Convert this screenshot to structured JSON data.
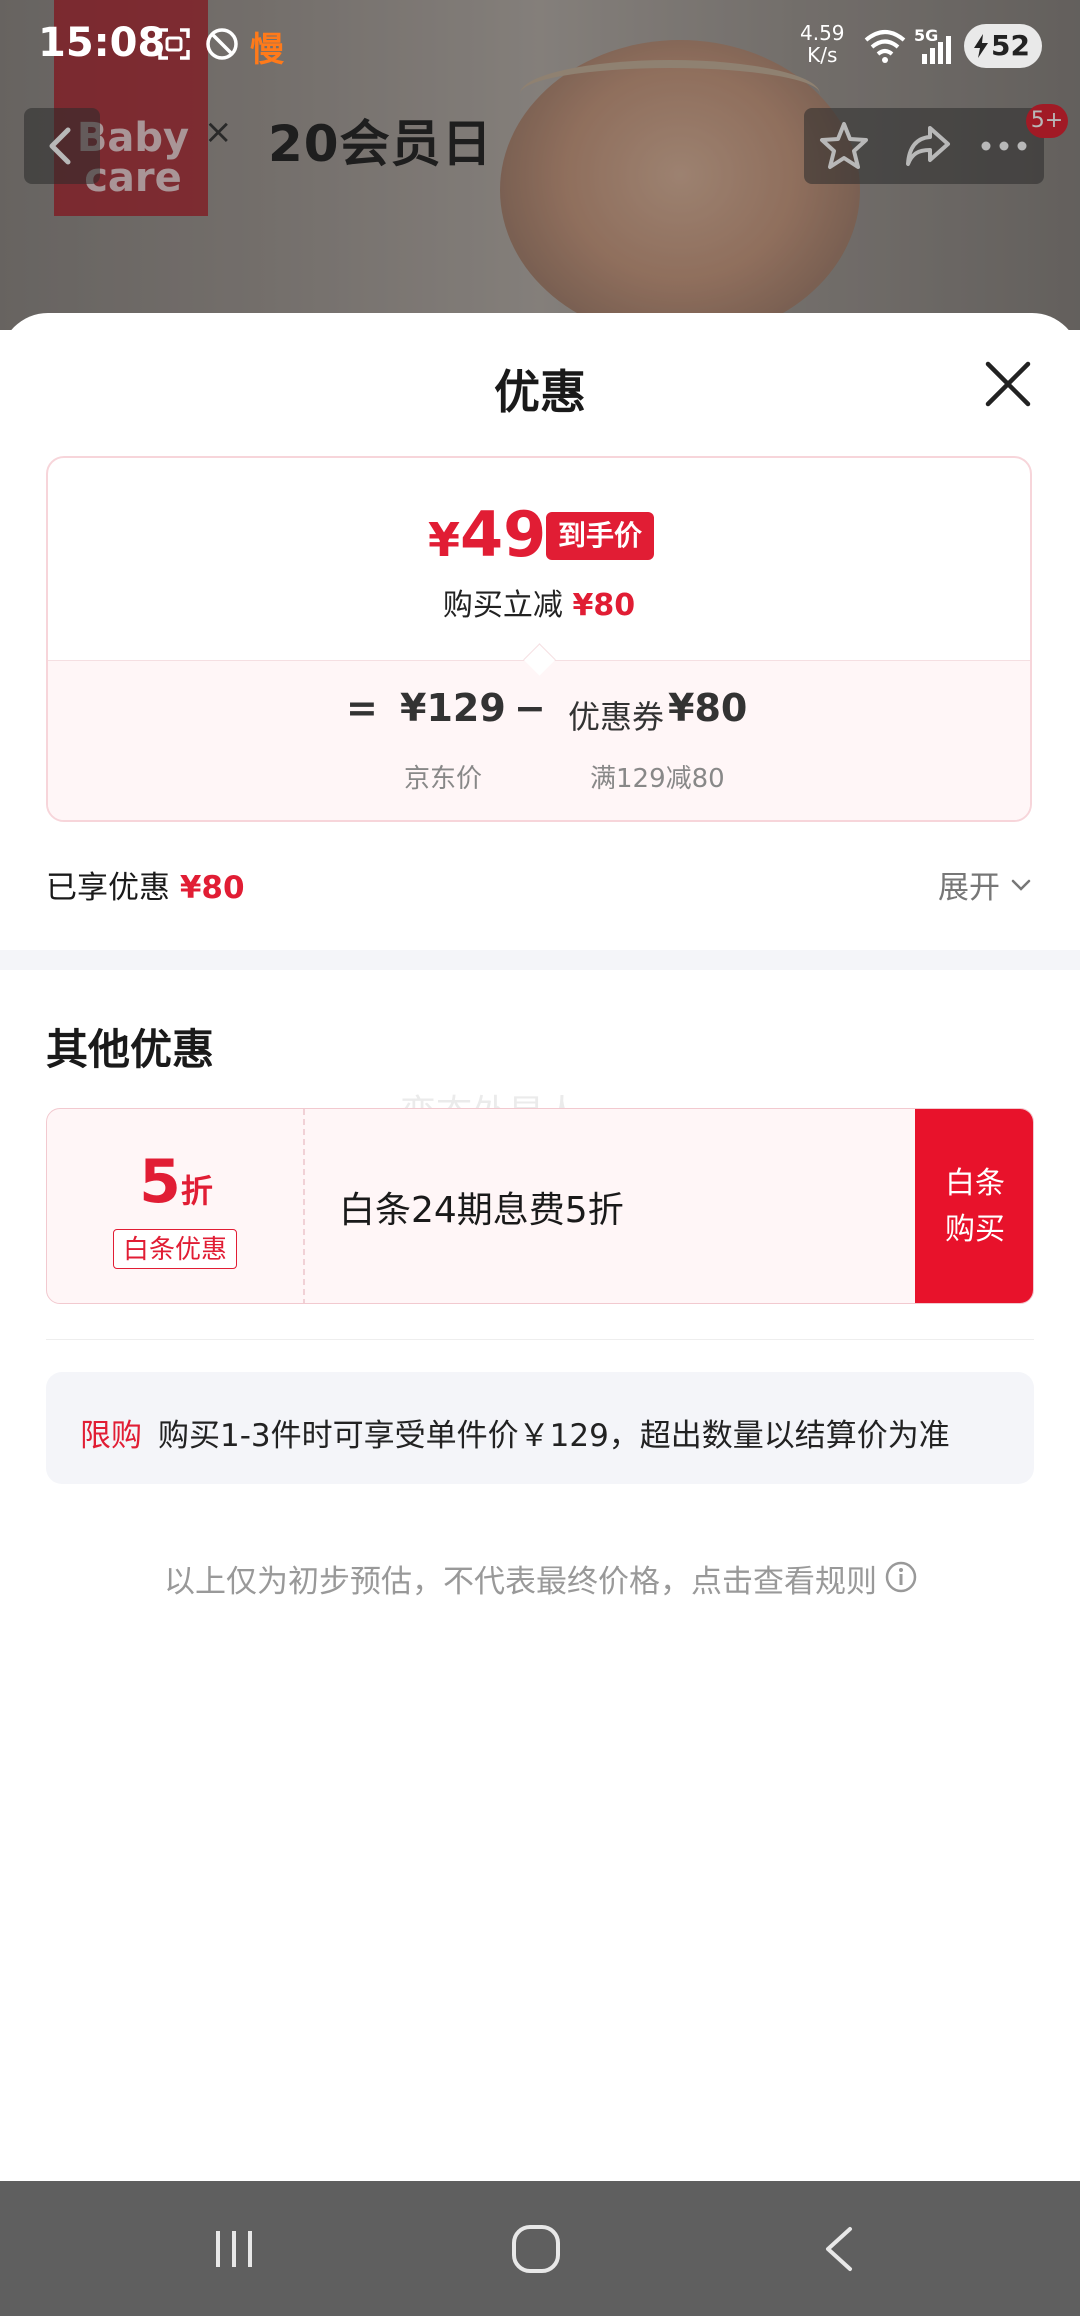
{
  "status_bar": {
    "time": "15:08",
    "slow_mode": "慢",
    "net_speed_value": "4.59",
    "net_speed_unit": "K/s",
    "network": "5G",
    "battery": "52"
  },
  "background": {
    "brand_line1": "Baby",
    "brand_line2": "care",
    "cross": "×",
    "campaign": "20会员日"
  },
  "top_bar": {
    "more_badge": "5+"
  },
  "sheet": {
    "title": "优惠"
  },
  "price_card": {
    "currency": "¥",
    "final_price": "49",
    "final_tag": "到手价",
    "instant_reduce_label": "购买立减",
    "instant_reduce_value": "¥80",
    "equals": "=",
    "jd_price": "¥129",
    "minus": "−",
    "coupon_label": "优惠券",
    "coupon_value": "¥80",
    "jd_price_caption": "京东价",
    "coupon_caption": "满129减80"
  },
  "enjoyed": {
    "label": "已享优惠",
    "value": "¥80",
    "expand_label": "展开"
  },
  "other_offers": {
    "title": "其他优惠",
    "watermark": "变态外星人",
    "items": [
      {
        "discount_number": "5",
        "discount_unit": "折",
        "tag": "白条优惠",
        "description": "白条24期息费5折",
        "button_line1": "白条",
        "button_line2": "购买"
      }
    ]
  },
  "limit": {
    "tag": "限购",
    "text": "购买1-3件时可享受单件价￥129，超出数量以结算价为准"
  },
  "footer_note": "以上仅为初步预估，不代表最终价格，点击查看规则",
  "colors": {
    "accent_red": "#e11d34",
    "button_red": "#e8122b",
    "status_orange": "#ff7a1a",
    "nav_gray": "#5f5f5f"
  },
  "icons": [
    "back-icon",
    "star-icon",
    "share-icon",
    "more-icon",
    "close-icon",
    "chevron-down-icon",
    "info-icon",
    "recent-apps-icon",
    "home-icon",
    "nav-back-icon",
    "screenshot-icon",
    "no-disturb-icon",
    "wifi-icon",
    "signal-icon",
    "battery-icon"
  ]
}
